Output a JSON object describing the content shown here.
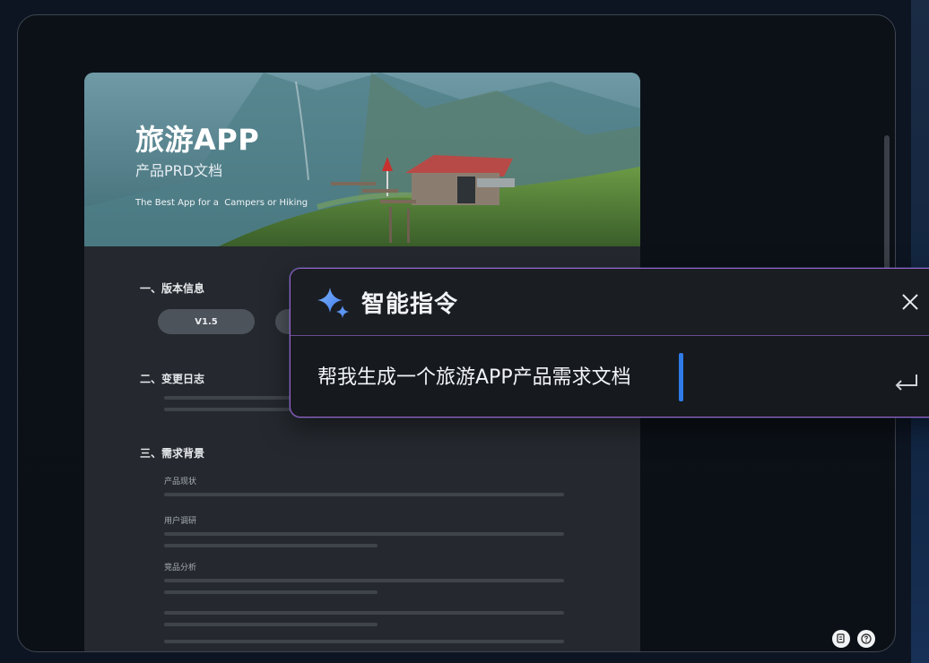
{
  "document": {
    "banner": {
      "title": "旅游APP",
      "subtitle": "产品PRD文档",
      "tagline": "The Best App for a  Campers or Hiking"
    },
    "sections": [
      {
        "title": "一、版本信息"
      },
      {
        "title": "二、变更日志"
      },
      {
        "title": "三、需求背景"
      }
    ],
    "version_pill": "V1.5",
    "sub_labels": [
      "产品现状",
      "用户调研",
      "竞品分析"
    ]
  },
  "dialog": {
    "title": "智能指令",
    "prompt": "帮我生成一个旅游APP产品需求文档",
    "icons": {
      "sparkle": "sparkle-icon",
      "close": "close-icon",
      "enter": "enter-icon"
    }
  },
  "bottom_icons": [
    "document-icon",
    "help-icon"
  ],
  "colors": {
    "accent_blue": "#2f7be8",
    "dialog_border": "#9a5fc9",
    "doc_background": "#25292f"
  }
}
